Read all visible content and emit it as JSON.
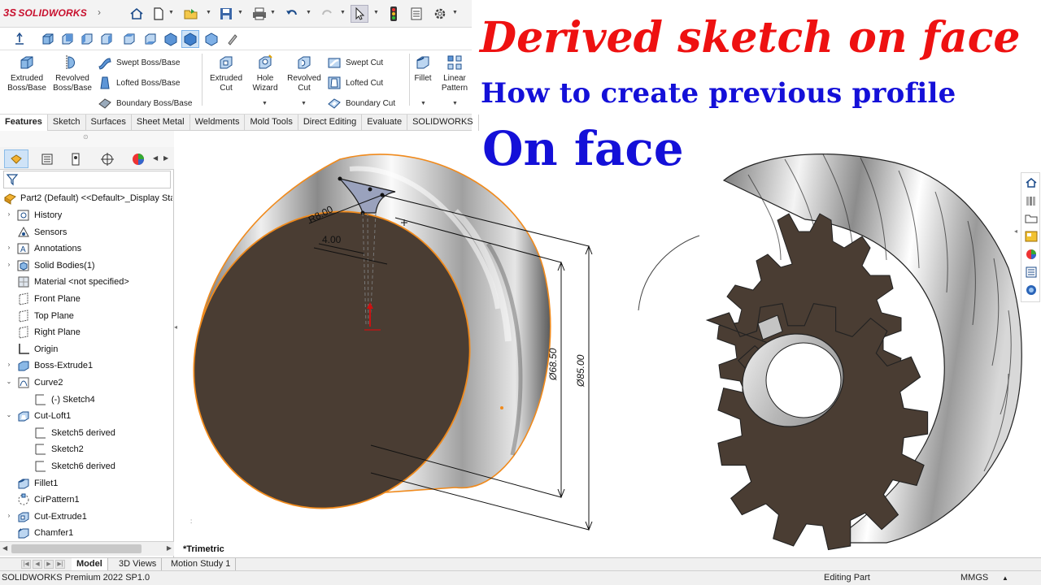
{
  "app": {
    "logo": "SOLIDWORKS"
  },
  "commands": {
    "extruded_boss": [
      "Extruded",
      "Boss/Base"
    ],
    "revolved_boss": [
      "Revolved",
      "Boss/Base"
    ],
    "swept_boss": "Swept Boss/Base",
    "lofted_boss": "Lofted Boss/Base",
    "boundary_boss": "Boundary Boss/Base",
    "extruded_cut": [
      "Extruded",
      "Cut"
    ],
    "hole_wizard": [
      "Hole",
      "Wizard"
    ],
    "revolved_cut": [
      "Revolved",
      "Cut"
    ],
    "swept_cut": "Swept Cut",
    "lofted_cut": "Lofted Cut",
    "boundary_cut": "Boundary Cut",
    "fillet": "Fillet",
    "linear_pattern": [
      "Linear",
      "Pattern"
    ]
  },
  "command_tabs": [
    "Features",
    "Sketch",
    "Surfaces",
    "Sheet Metal",
    "Weldments",
    "Mold Tools",
    "Direct Editing",
    "Evaluate",
    "SOLIDWORKS"
  ],
  "feature_tree": {
    "part": "Part2 (Default) <<Default>_Display State",
    "items": [
      {
        "label": "History",
        "icon": "history-icon"
      },
      {
        "label": "Sensors",
        "icon": "sensors-icon"
      },
      {
        "label": "Annotations",
        "icon": "annotations-icon"
      },
      {
        "label": "Solid Bodies(1)",
        "icon": "solid-bodies-icon"
      },
      {
        "label": "Material <not specified>",
        "icon": "material-icon"
      },
      {
        "label": "Front Plane",
        "icon": "plane-icon"
      },
      {
        "label": "Top Plane",
        "icon": "plane-icon"
      },
      {
        "label": "Right Plane",
        "icon": "plane-icon"
      },
      {
        "label": "Origin",
        "icon": "origin-icon"
      },
      {
        "label": "Boss-Extrude1",
        "icon": "extrude-icon"
      },
      {
        "label": "Curve2",
        "icon": "curve-icon"
      },
      {
        "label": "(-) Sketch4",
        "icon": "sketch-icon"
      },
      {
        "label": "Cut-Loft1",
        "icon": "loft-icon"
      },
      {
        "label": "Sketch5 derived",
        "icon": "sketch-icon"
      },
      {
        "label": "Sketch2",
        "icon": "sketch-icon"
      },
      {
        "label": "Sketch6 derived",
        "icon": "sketch-icon"
      },
      {
        "label": "Fillet1",
        "icon": "fillet-icon"
      },
      {
        "label": "CirPattern1",
        "icon": "pattern-icon"
      },
      {
        "label": "Cut-Extrude1",
        "icon": "cut-extrude-icon"
      },
      {
        "label": "Chamfer1",
        "icon": "chamfer-icon"
      }
    ]
  },
  "bottom_tabs": [
    "Model",
    "3D Views",
    "Motion Study 1"
  ],
  "status": {
    "edition": "SOLIDWORKS Premium 2022 SP1.0",
    "mode": "Editing Part",
    "units": "MMGS"
  },
  "view": {
    "orientation": "*Trimetric"
  },
  "dimensions": {
    "radius": "R8.00",
    "width": "4.00",
    "dia_inner": "Ø68.50",
    "dia_outer": "Ø85.00"
  },
  "overlay": {
    "line1": "Derived sketch on face",
    "line2": "How to create previous profile",
    "line3": "On face"
  },
  "colors": {
    "title_red": "#ee1111",
    "title_blue": "#1410d8",
    "edge_orange": "#f08a1c",
    "face_brown": "#4a3d33"
  }
}
